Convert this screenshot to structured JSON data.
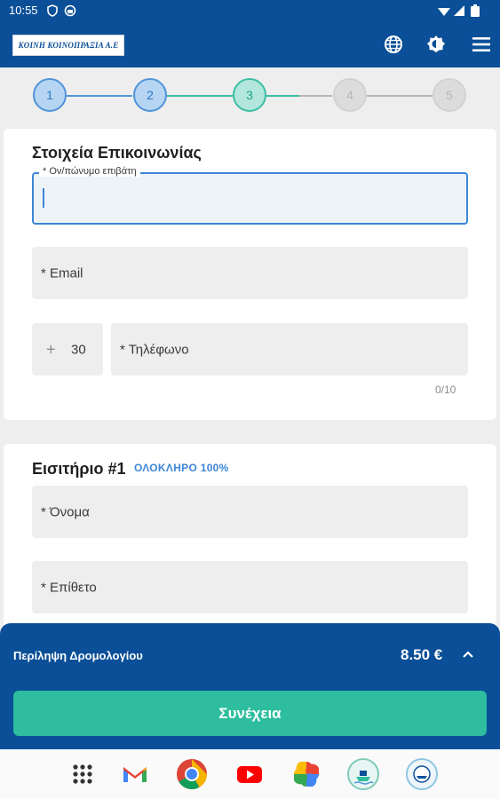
{
  "status_bar": {
    "time": "10:55",
    "icons": [
      "shield-icon",
      "sync-icon",
      "wifi-icon",
      "signal-icon",
      "battery-icon"
    ]
  },
  "header": {
    "logo_text": "KOINH ΚΟΙΝΟΠΡΑΞΙΑ Α.Ε",
    "actions": [
      "globe-icon",
      "brightness-icon",
      "menu-icon"
    ],
    "bg_color": "#0a4f97"
  },
  "stepper": {
    "steps": [
      {
        "label": "1",
        "state": "done"
      },
      {
        "label": "2",
        "state": "done"
      },
      {
        "label": "3",
        "state": "active"
      },
      {
        "label": "4",
        "state": "todo"
      },
      {
        "label": "5",
        "state": "todo"
      }
    ]
  },
  "contact": {
    "title": "Στοιχεία Επικοινωνίας",
    "name_label": "*  Ον/πώνυμο επιβάτη",
    "email_label": "*  Email",
    "country_code_prefix": "+",
    "country_code": "30",
    "phone_label": "*  Τηλέφωνο",
    "phone_counter": "0/10"
  },
  "ticket": {
    "title": "Εισιτήριο #1",
    "fare_badge": "ΟΛΟΚΛΗΡΟ 100%",
    "first_name_label": "*  Όνομα",
    "last_name_label": "*  Επίθετο"
  },
  "summary": {
    "label": "Περίληψη Δρομολογίου",
    "price": "8.50 €",
    "continue_label": "Συνέχεια",
    "accent_color": "#2ebd9e"
  },
  "taskbar": {
    "apps": [
      "apps-grid-icon",
      "gmail-icon",
      "chrome-icon",
      "youtube-icon",
      "photos-icon",
      "ferry-app-icon",
      "ferry-app-2-icon"
    ]
  }
}
